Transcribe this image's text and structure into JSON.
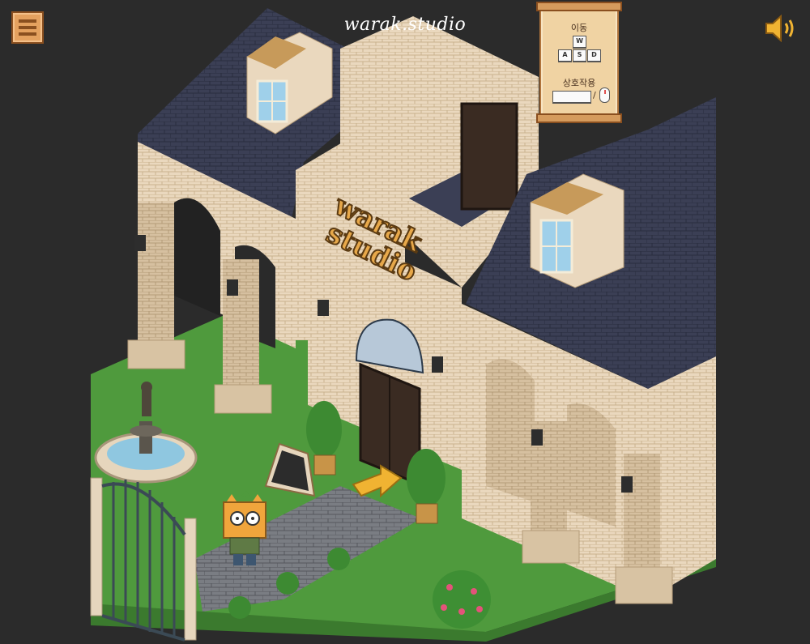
{
  "header": {
    "title": "warak.studio",
    "menu_icon": "hamburger-menu-icon",
    "sound_icon": "speaker-on-icon"
  },
  "controls": {
    "move_label": "이동",
    "keys": [
      "W",
      "A",
      "S",
      "D"
    ],
    "interact_label": "상호작용",
    "interact_keys": [
      "space-key-icon",
      "mouse-left-click-icon"
    ]
  },
  "sign": {
    "line1": "warak",
    "line2": "studio"
  },
  "colors": {
    "background": "#2b2b2b",
    "roof": "#3b3f55",
    "wall": "#ead8be",
    "grass": "#4f9a3d",
    "sign_text": "#e7a84a",
    "arrow": "#f0b332"
  }
}
